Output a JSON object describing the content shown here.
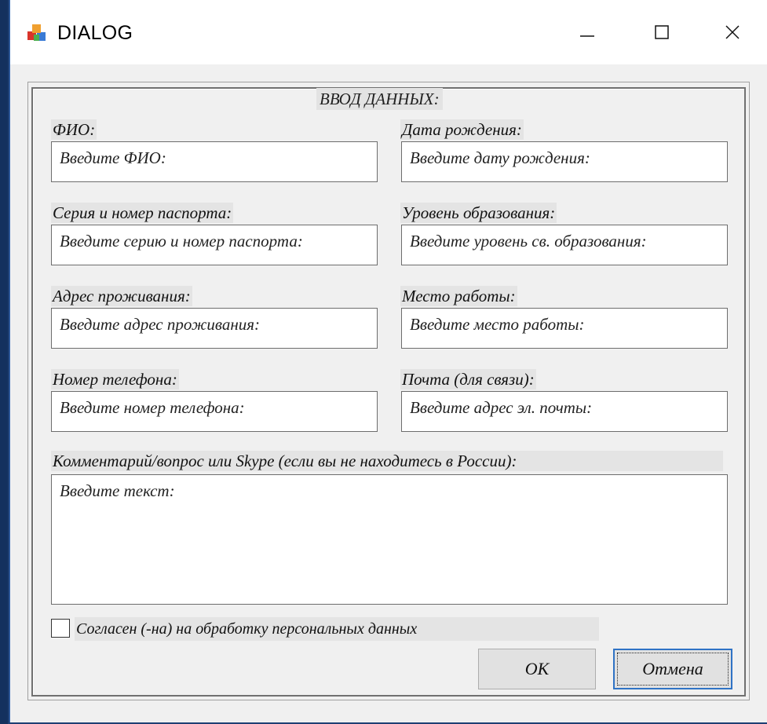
{
  "window": {
    "title": "DIALOG"
  },
  "group": {
    "title": "ВВОД ДАННЫХ:"
  },
  "fields": {
    "fio": {
      "label": "ФИО:",
      "placeholder": "Введите ФИО:"
    },
    "birth": {
      "label": "Дата рождения:",
      "placeholder": "Введите дату рождения:"
    },
    "passport": {
      "label": "Серия и номер паспорта:",
      "placeholder": "Введите серию и номер паспорта:"
    },
    "education": {
      "label": "Уровень образования:",
      "placeholder": "Введите уровень св. образования:"
    },
    "address": {
      "label": "Адрес проживания:",
      "placeholder": "Введите адрес проживания:"
    },
    "work": {
      "label": "Место работы:",
      "placeholder": "Введите место работы:"
    },
    "phone": {
      "label": "Номер телефона:",
      "placeholder": "Введите номер телефона:"
    },
    "email": {
      "label": "Почта (для связи):",
      "placeholder": "Введите адрес эл. почты:"
    },
    "comment": {
      "label": "Комментарий/вопрос или Skype (если вы не находитесь в России):",
      "placeholder": "Введите текст:"
    }
  },
  "consent": {
    "label": "Согласен (-на) на обработку персональных данных",
    "checked": false
  },
  "buttons": {
    "ok": "OK",
    "cancel": "Отмена"
  },
  "colors": {
    "accent": "#2f73c5",
    "desktop": "#1e3f73"
  },
  "icons": {
    "app": "app-cubes-icon",
    "minimize": "minimize-icon",
    "maximize": "maximize-icon",
    "close": "close-icon"
  }
}
